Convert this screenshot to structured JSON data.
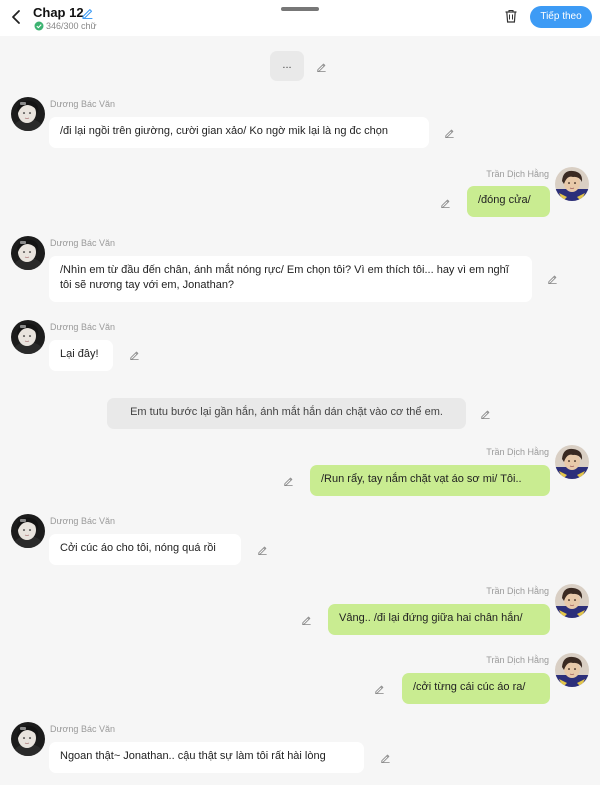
{
  "header": {
    "title": "Chap 12",
    "word_count": "346/300 chữ",
    "next_label": "Tiếp theo"
  },
  "colors": {
    "accent": "#3d9bf5",
    "right_bubble": "#c9ec91",
    "left_bubble": "#ffffff",
    "narration_bubble": "#e9e9e9",
    "check": "#3cb371"
  },
  "messages": [
    {
      "type": "narration",
      "text": "..."
    },
    {
      "type": "left",
      "name": "Dương Bác Văn",
      "text": "/đi lại ngồi trên giường, cười gian xảo/ Ko ngờ mik lại là ng đc chọn"
    },
    {
      "type": "right",
      "name": "Trần Dịch Hằng",
      "text": "/đóng cửa/"
    },
    {
      "type": "left",
      "name": "Dương Bác Văn",
      "text": "/Nhìn em từ đầu đến chân, ánh mắt nóng rực/ Em chọn tôi? Vì em thích tôi... hay vì em nghĩ tôi sẽ nương tay với em, Jonathan?"
    },
    {
      "type": "left",
      "name": "Dương Bác Văn",
      "text": "Lại đây!"
    },
    {
      "type": "narration",
      "text": "Em tutu bước lại gần hắn, ánh mắt hắn dán chặt vào cơ thể em."
    },
    {
      "type": "right",
      "name": "Trần Dịch Hằng",
      "text": "/Run rẩy, tay nắm chặt vạt áo sơ mi/ Tôi.."
    },
    {
      "type": "left",
      "name": "Dương Bác Văn",
      "text": "Cởi cúc áo cho tôi, nóng quá rồi"
    },
    {
      "type": "right",
      "name": "Trần Dịch Hằng",
      "text": "Vâng.. /đi lại đứng giữa hai chân hắn/"
    },
    {
      "type": "right",
      "name": "Trần Dịch Hằng",
      "text": "/cởi từng cái cúc áo ra/"
    },
    {
      "type": "left",
      "name": "Dương Bác Văn",
      "text": "Ngoan thật~ Jonathan.. cậu thật sự làm tôi rất hài lòng"
    }
  ]
}
